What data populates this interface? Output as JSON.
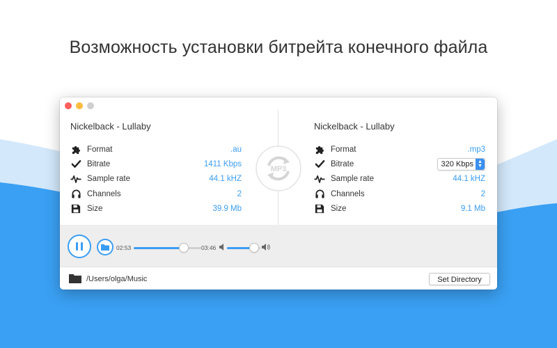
{
  "headline": "Возможность установки битрейта конечного файла",
  "colors": {
    "accent": "#3a9df3",
    "wave_light": "#cfe6fb",
    "wave_dark": "#3aa0f3"
  },
  "source": {
    "title": "Nickelback - Lullaby",
    "props": [
      {
        "icon": "puzzle-icon",
        "label": "Format",
        "value": ".au"
      },
      {
        "icon": "checkmark-icon",
        "label": "Bitrate",
        "value": "1411 Kbps"
      },
      {
        "icon": "waveform-icon",
        "label": "Sample rate",
        "value": "44.1 kHZ"
      },
      {
        "icon": "headphones-icon",
        "label": "Channels",
        "value": "2"
      },
      {
        "icon": "floppy-disk-icon",
        "label": "Size",
        "value": "39.9 Mb"
      }
    ]
  },
  "target": {
    "title": "Nickelback - Lullaby",
    "props": [
      {
        "icon": "puzzle-icon",
        "label": "Format",
        "value": ".mp3"
      },
      {
        "icon": "checkmark-icon",
        "label": "Bitrate",
        "value": "320 Kbps"
      },
      {
        "icon": "waveform-icon",
        "label": "Sample rate",
        "value": "44.1 kHZ"
      },
      {
        "icon": "headphones-icon",
        "label": "Channels",
        "value": "2"
      },
      {
        "icon": "floppy-disk-icon",
        "label": "Size",
        "value": "9.1 Mb"
      }
    ]
  },
  "convert_badge": "MP3",
  "player": {
    "elapsed": "02:53",
    "total": "03:46",
    "progress_fraction": 0.74,
    "volume_fraction": 0.82
  },
  "footer": {
    "path": "/Users/olga/Music",
    "set_directory_label": "Set Directory"
  }
}
